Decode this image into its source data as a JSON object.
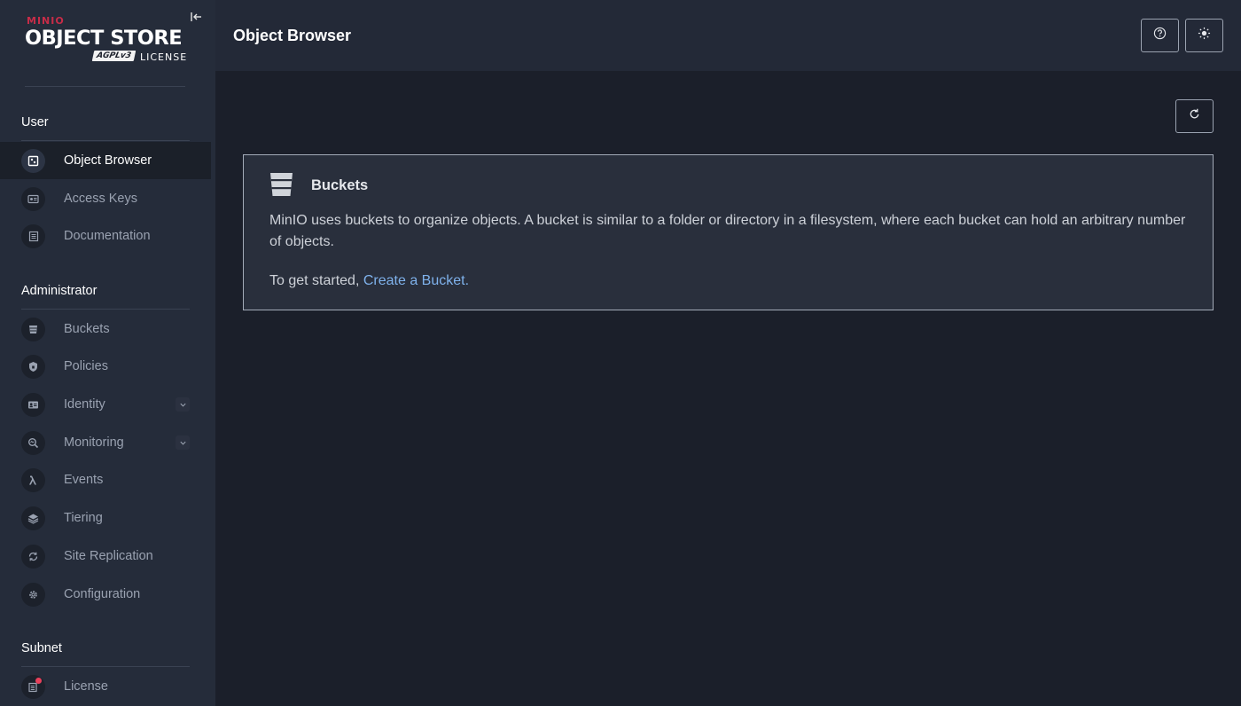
{
  "logo": {
    "brand": "MINIO",
    "product": "OBJECT STORE",
    "agpl": "AGPLv3",
    "license": "LICENSE"
  },
  "sidebar": {
    "sections": {
      "user": "User",
      "admin": "Administrator",
      "subnet": "Subnet"
    },
    "items": {
      "object_browser": "Object Browser",
      "access_keys": "Access Keys",
      "documentation": "Documentation",
      "buckets": "Buckets",
      "policies": "Policies",
      "identity": "Identity",
      "monitoring": "Monitoring",
      "events": "Events",
      "tiering": "Tiering",
      "site_replication": "Site Replication",
      "configuration": "Configuration",
      "license": "License"
    }
  },
  "header": {
    "title": "Object Browser"
  },
  "card": {
    "title": "Buckets",
    "description": "MinIO uses buckets to organize objects. A bucket is similar to a folder or directory in a filesystem, where each bucket can hold an arbitrary number of objects.",
    "start_prefix": "To get started, ",
    "start_link": "Create a Bucket."
  },
  "colors": {
    "sidebar_bg": "#252c3a",
    "main_bg": "#1b1f2a",
    "topbar_bg": "#232937",
    "link": "#7fb2ec",
    "brand_red": "#c72c48",
    "license_badge": "#e8405b"
  }
}
